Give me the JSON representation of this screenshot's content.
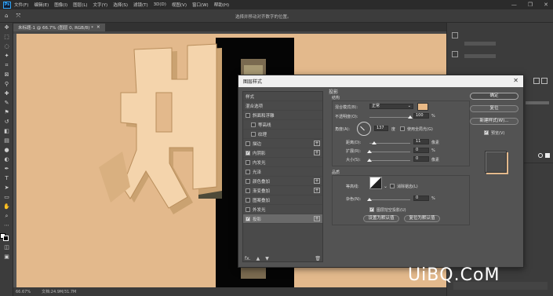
{
  "app": {
    "logo": "Ps",
    "menus": [
      "文件(F)",
      "编辑(E)",
      "图像(I)",
      "图层(L)",
      "文字(Y)",
      "选择(S)",
      "滤镜(T)",
      "3D(D)",
      "视图(V)",
      "窗口(W)",
      "帮助(H)"
    ],
    "win_min": "—",
    "win_max": "❐",
    "win_close": "✕"
  },
  "options": {
    "move_icon": "⤧",
    "hint": "选择并移动对齐数字的位置。"
  },
  "document": {
    "tab_label": "未标题-1 @ 66.7% (图层 0, RGB/8) *",
    "tab_close": "✕"
  },
  "status": {
    "zoom": "66.67%",
    "doc": "文档:24.9M/31.7M"
  },
  "watermark": "UiBQ.CoM",
  "dialog": {
    "title": "图层样式",
    "close": "✕",
    "list_header": "样式",
    "list_options": "混合选项",
    "items": [
      {
        "label": "斜面和浮雕",
        "checked": false,
        "plus": false,
        "indent": false
      },
      {
        "label": "等高线",
        "checked": false,
        "plus": false,
        "indent": true
      },
      {
        "label": "纹理",
        "checked": false,
        "plus": false,
        "indent": true
      },
      {
        "label": "描边",
        "checked": false,
        "plus": true,
        "indent": false
      },
      {
        "label": "内阴影",
        "checked": true,
        "plus": true,
        "indent": false
      },
      {
        "label": "内发光",
        "checked": false,
        "plus": false,
        "indent": false
      },
      {
        "label": "光泽",
        "checked": false,
        "plus": false,
        "indent": false
      },
      {
        "label": "颜色叠加",
        "checked": false,
        "plus": true,
        "indent": false
      },
      {
        "label": "渐变叠加",
        "checked": false,
        "plus": true,
        "indent": false
      },
      {
        "label": "图案叠加",
        "checked": false,
        "plus": false,
        "indent": false
      },
      {
        "label": "外发光",
        "checked": false,
        "plus": false,
        "indent": false
      },
      {
        "label": "投影",
        "checked": true,
        "plus": true,
        "indent": false,
        "selected": true
      }
    ],
    "foot": [
      "fx.",
      "▲",
      "▼",
      "🗑"
    ],
    "shadow": {
      "section": "投影",
      "structure": "结构",
      "blend_label": "混合模式(B):",
      "blend_value": "正常",
      "blend_color": "#e8b986",
      "opacity_label": "不透明度(O):",
      "opacity_value": "100",
      "opacity_unit": "%",
      "angle_label": "角度(A):",
      "angle_value": "137",
      "angle_unit": "度",
      "global_light": "使用全局光(G)",
      "distance_label": "距离(D):",
      "distance_value": "11",
      "distance_unit": "像素",
      "spread_label": "扩展(R):",
      "spread_value": "0",
      "spread_unit": "%",
      "size_label": "大小(S):",
      "size_value": "0",
      "size_unit": "像素",
      "quality": "品质",
      "contour_label": "等高线:",
      "antialias": "消除锯齿(L)",
      "noise_label": "杂色(N):",
      "noise_value": "0",
      "noise_unit": "%",
      "knockout": "图层挖空投影(U)",
      "default_btn": "设置为默认值",
      "reset_btn": "复位为默认值"
    },
    "ok": "确定",
    "cancel": "复位",
    "new_style": "新建样式(W)...",
    "preview": "预览(V)"
  }
}
